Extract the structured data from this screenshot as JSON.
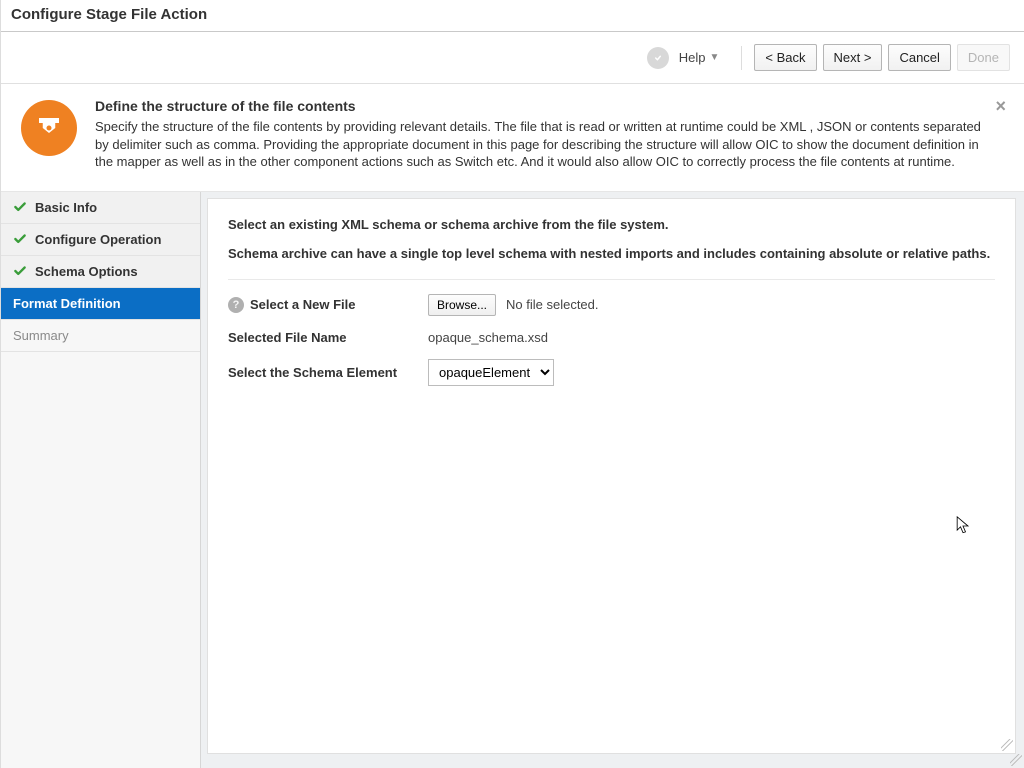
{
  "window": {
    "title": "Configure Stage File Action"
  },
  "toolbar": {
    "help_label": "Help",
    "back_label": "<  Back",
    "next_label": "Next  >",
    "cancel_label": "Cancel",
    "done_label": "Done"
  },
  "banner": {
    "heading": "Define the structure of the file contents",
    "description": "Specify the structure of the file contents by providing relevant details. The file that is read or written at runtime could be XML , JSON or contents separated by delimiter such as comma. Providing the appropriate document in this page for describing the structure will allow OIC to show the document definition in the mapper as well as in the other component actions such as Switch etc. And it would also allow OIC to correctly process the file contents at runtime."
  },
  "sidebar": {
    "items": [
      {
        "label": "Basic Info",
        "state": "done"
      },
      {
        "label": "Configure Operation",
        "state": "done"
      },
      {
        "label": "Schema Options",
        "state": "done"
      },
      {
        "label": "Format Definition",
        "state": "active"
      },
      {
        "label": "Summary",
        "state": "pending"
      }
    ]
  },
  "content": {
    "intro1": "Select an existing XML schema or schema archive from the file system.",
    "intro2": "Schema archive can have a single top level schema with nested imports and includes containing absolute or relative paths.",
    "select_new_file_label": "Select a New File",
    "browse_label": "Browse...",
    "no_file_text": "No file selected.",
    "selected_file_label": "Selected File Name",
    "selected_file_value": "opaque_schema.xsd",
    "schema_element_label": "Select the Schema Element",
    "schema_element_value": "opaqueElement"
  },
  "icons": {
    "close": "×"
  }
}
